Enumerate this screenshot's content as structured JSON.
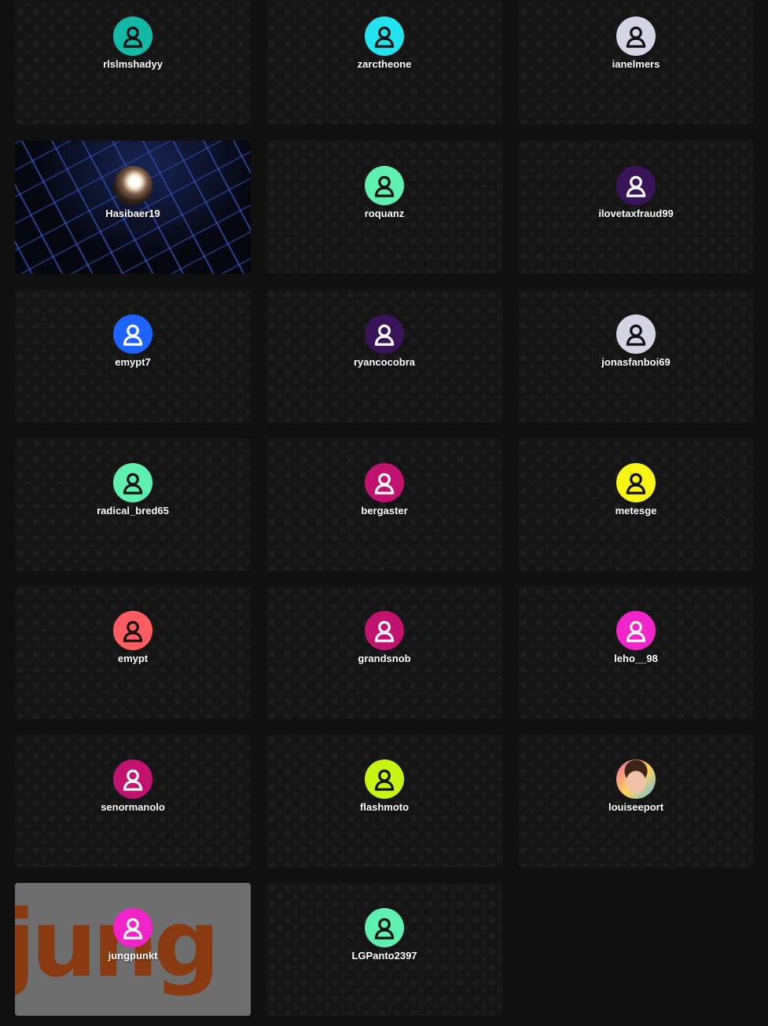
{
  "users": [
    {
      "name": "rlslmshadyy",
      "avatar_color": "#14b8a6",
      "icon_color": "#111111"
    },
    {
      "name": "zarctheone",
      "avatar_color": "#22e3ee",
      "icon_color": "#111111"
    },
    {
      "name": "ianelmers",
      "avatar_color": "#d4d4e4",
      "icon_color": "#111111"
    },
    {
      "name": "Hasibaer19",
      "avatar": "photo-glow",
      "background": "keyboard"
    },
    {
      "name": "roquanz",
      "avatar_color": "#5ef0b0",
      "icon_color": "#111111"
    },
    {
      "name": "ilovetaxfraud99",
      "avatar_color": "#3a1458",
      "icon_color": "#ffffff"
    },
    {
      "name": "emypt7",
      "avatar_color": "#1f63ff",
      "icon_color": "#ffffff"
    },
    {
      "name": "ryancocobra",
      "avatar_color": "#3a1458",
      "icon_color": "#ffffff"
    },
    {
      "name": "jonasfanboi69",
      "avatar_color": "#d4d4e4",
      "icon_color": "#111111"
    },
    {
      "name": "radical_bred65",
      "avatar_color": "#5ef0b0",
      "icon_color": "#111111"
    },
    {
      "name": "bergaster",
      "avatar_color": "#c0126e",
      "icon_color": "#ffffff"
    },
    {
      "name": "metesge",
      "avatar_color": "#f8f414",
      "icon_color": "#111111"
    },
    {
      "name": "emypt",
      "avatar_color": "#ff5c62",
      "icon_color": "#111111"
    },
    {
      "name": "grandsnob",
      "avatar_color": "#c0126e",
      "icon_color": "#ffffff"
    },
    {
      "name": "leho__98",
      "avatar_color": "#f024c8",
      "icon_color": "#ffffff"
    },
    {
      "name": "senormanolo",
      "avatar_color": "#c0126e",
      "icon_color": "#ffffff"
    },
    {
      "name": "flashmoto",
      "avatar_color": "#c8f414",
      "icon_color": "#111111"
    },
    {
      "name": "louiseeport",
      "avatar": "photo-face"
    },
    {
      "name": "jungpunkt",
      "avatar_color": "#f024c8",
      "icon_color": "#ffffff",
      "background": "jung",
      "background_text": "jung"
    },
    {
      "name": "LGPanto2397",
      "avatar_color": "#5ef0b0",
      "icon_color": "#111111"
    }
  ]
}
